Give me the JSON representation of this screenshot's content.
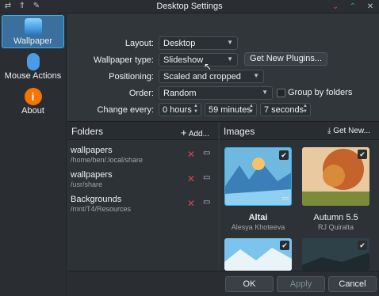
{
  "window": {
    "title": "Desktop Settings"
  },
  "sidebar": {
    "items": [
      {
        "label": "Wallpaper",
        "icon": "wallpaper-icon"
      },
      {
        "label": "Mouse Actions",
        "icon": "mouse-icon"
      },
      {
        "label": "About",
        "icon": "info-icon"
      }
    ]
  },
  "form": {
    "layout_label": "Layout:",
    "layout_value": "Desktop",
    "wallpaper_type_label": "Wallpaper type:",
    "wallpaper_type_value": "Slideshow",
    "get_new_plugins": "Get New Plugins...",
    "positioning_label": "Positioning:",
    "positioning_value": "Scaled and cropped",
    "order_label": "Order:",
    "order_value": "Random",
    "group_by_folders": "Group by folders",
    "change_every_label": "Change every:",
    "hours_value": "0 hours",
    "minutes_value": "59 minutes",
    "seconds_value": "7 seconds"
  },
  "folders": {
    "title": "Folders",
    "add_label": "Add...",
    "items": [
      {
        "name": "wallpapers",
        "path": "/home/ben/.local/share"
      },
      {
        "name": "wallpapers",
        "path": "/usr/share"
      },
      {
        "name": "Backgrounds",
        "path": "/mnt/T4/Resources"
      }
    ]
  },
  "images": {
    "title": "Images",
    "get_new_label": "Get New...",
    "items": [
      {
        "name": "Altai",
        "author": "Alesya Khoteeva"
      },
      {
        "name": "Autumn 5.5",
        "author": "RJ Quiralta"
      }
    ]
  },
  "buttons": {
    "ok": "OK",
    "apply": "Apply",
    "cancel": "Cancel"
  },
  "colors": {
    "accent": "#3daee9",
    "remove": "#da4453"
  }
}
